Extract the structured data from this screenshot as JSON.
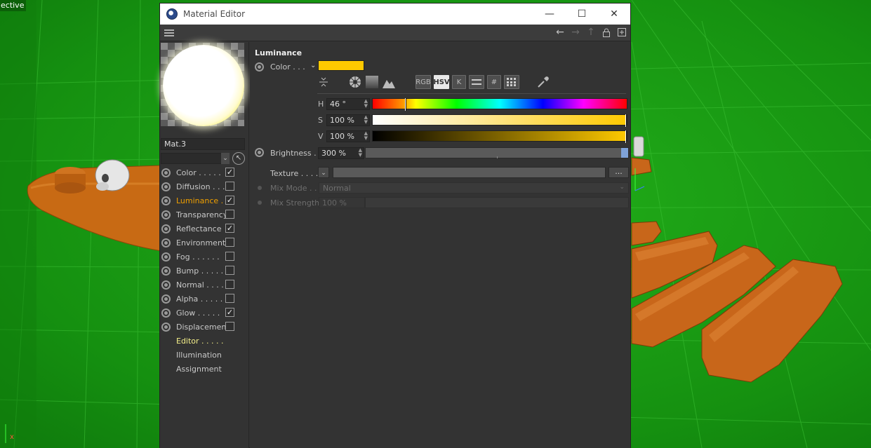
{
  "viewport": {
    "label": "ective",
    "axis_x": "x"
  },
  "window": {
    "title": "Material Editor",
    "controls": {
      "minimize": "—",
      "maximize": "☐",
      "close": "✕"
    }
  },
  "material": {
    "name": "Mat.3",
    "preview_color": "#fff6a0"
  },
  "channels": [
    {
      "label": "Color . . . . .",
      "checked": true,
      "active": false
    },
    {
      "label": "Diffusion . . .",
      "checked": false,
      "active": false
    },
    {
      "label": "Luminance . .",
      "checked": true,
      "active": true
    },
    {
      "label": "Transparency",
      "checked": false,
      "active": false
    },
    {
      "label": "Reflectance",
      "checked": true,
      "active": false
    },
    {
      "label": "Environment",
      "checked": false,
      "active": false
    },
    {
      "label": "Fog . . . . . .",
      "checked": false,
      "active": false
    },
    {
      "label": "Bump . . . . .",
      "checked": false,
      "active": false
    },
    {
      "label": "Normal . . . .",
      "checked": false,
      "active": false
    },
    {
      "label": "Alpha . . . . .",
      "checked": false,
      "active": false
    },
    {
      "label": "Glow . . . . .",
      "checked": true,
      "active": false
    },
    {
      "label": "Displacement",
      "checked": false,
      "active": false
    }
  ],
  "extra_items": [
    {
      "label": "Editor . . . . ."
    },
    {
      "label": "Illumination"
    },
    {
      "label": "Assignment"
    }
  ],
  "luminance": {
    "title": "Luminance",
    "color_label": "Color . . .",
    "color_swatch": "#fec900",
    "modes": {
      "rgb": "RGB",
      "hsv": "HSV",
      "k": "K",
      "hash": "#"
    },
    "h_label": "H",
    "h_value": "46 °",
    "s_label": "S",
    "s_value": "100 %",
    "v_label": "V",
    "v_value": "100 %",
    "hue_fraction": 0.128,
    "brightness_label": "Brightness . .",
    "brightness_value": "300 %",
    "texture_label": "Texture . . . .",
    "texture_button": "...",
    "mixmode_label": "Mix Mode . .",
    "mixmode_value": "Normal",
    "mixstrength_label": "Mix Strength",
    "mixstrength_value": "100 %"
  }
}
